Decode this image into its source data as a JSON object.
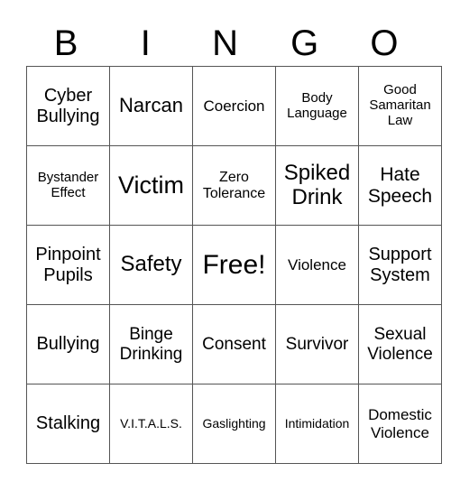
{
  "header": [
    "B",
    "I",
    "N",
    "G",
    "O"
  ],
  "grid": [
    [
      {
        "text": "Cyber Bullying",
        "size": "s20"
      },
      {
        "text": "Narcan",
        "size": "s22"
      },
      {
        "text": "Coercion",
        "size": "s17"
      },
      {
        "text": "Body Language",
        "size": "s15"
      },
      {
        "text": "Good Samaritan Law",
        "size": "s15"
      }
    ],
    [
      {
        "text": "Bystander Effect",
        "size": "s15"
      },
      {
        "text": "Victim",
        "size": "s27"
      },
      {
        "text": "Zero Tolerance",
        "size": "s16"
      },
      {
        "text": "Spiked Drink",
        "size": "s24"
      },
      {
        "text": "Hate Speech",
        "size": "s21"
      }
    ],
    [
      {
        "text": "Pinpoint Pupils",
        "size": "s20"
      },
      {
        "text": "Safety",
        "size": "s24"
      },
      {
        "text": "Free!",
        "size": "s30"
      },
      {
        "text": "Violence",
        "size": "s17"
      },
      {
        "text": "Support System",
        "size": "s20"
      }
    ],
    [
      {
        "text": "Bullying",
        "size": "s20"
      },
      {
        "text": "Binge Drinking",
        "size": "s19"
      },
      {
        "text": "Consent",
        "size": "s19"
      },
      {
        "text": "Survivor",
        "size": "s19"
      },
      {
        "text": "Sexual Violence",
        "size": "s19"
      }
    ],
    [
      {
        "text": "Stalking",
        "size": "s20"
      },
      {
        "text": "V.I.T.A.L.S.",
        "size": "s14"
      },
      {
        "text": "Gaslighting",
        "size": "s14"
      },
      {
        "text": "Intimidation",
        "size": "s14"
      },
      {
        "text": "Domestic Violence",
        "size": "s17"
      }
    ]
  ]
}
